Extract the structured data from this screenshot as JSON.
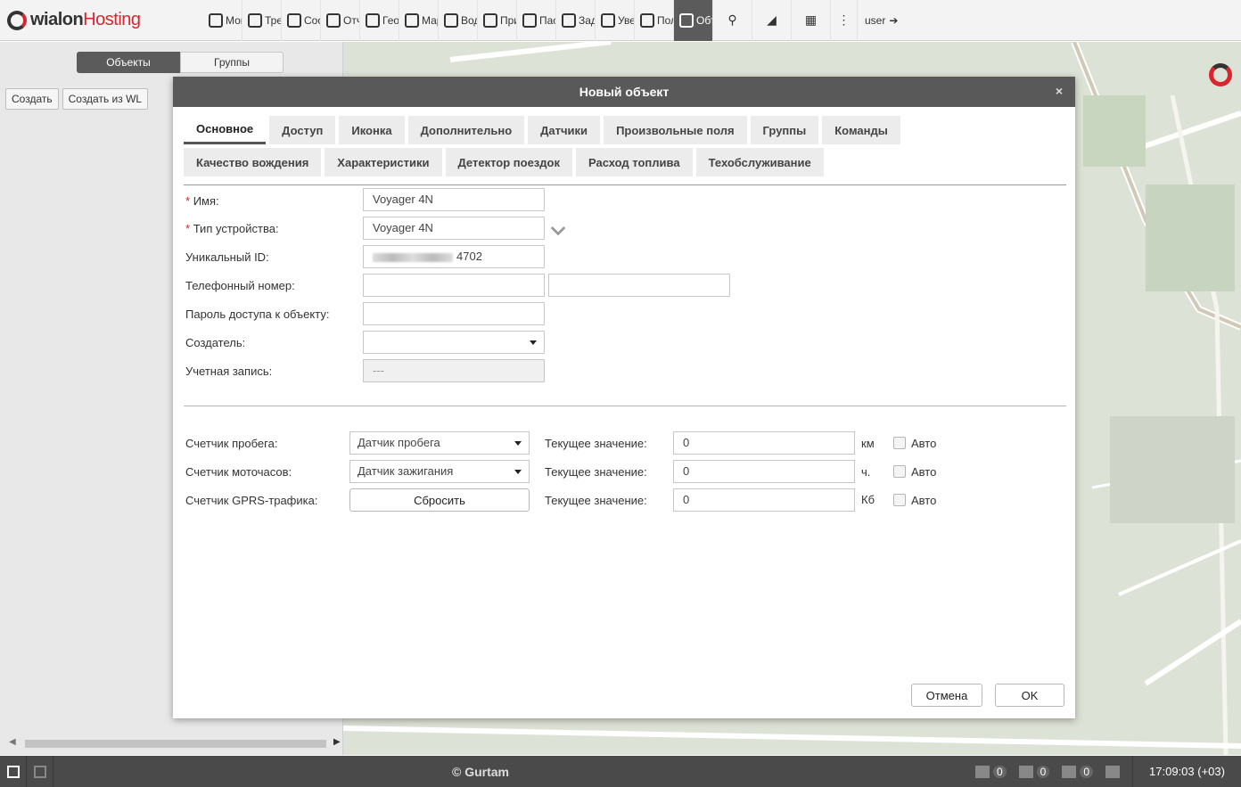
{
  "app": {
    "logo_main": "wialon",
    "logo_accent": "Hosting",
    "user": "user"
  },
  "menu": [
    {
      "label": "Мон",
      "icon": "globe-icon"
    },
    {
      "label": "Тре",
      "icon": "flag-icon"
    },
    {
      "label": "Соо",
      "icon": "list-icon"
    },
    {
      "label": "Отч",
      "icon": "report-icon"
    },
    {
      "label": "Гео",
      "icon": "geofence-icon"
    },
    {
      "label": "Мар",
      "icon": "route-icon"
    },
    {
      "label": "Вод",
      "icon": "steering-wheel-icon"
    },
    {
      "label": "При",
      "icon": "trailer-icon"
    },
    {
      "label": "Пас",
      "icon": "passenger-icon"
    },
    {
      "label": "Зад",
      "icon": "task-icon"
    },
    {
      "label": "Уве",
      "icon": "clock-icon"
    },
    {
      "label": "Пол",
      "icon": "user-icon"
    },
    {
      "label": "Объ",
      "icon": "vehicle-icon"
    }
  ],
  "left_panel": {
    "seg_objects": "Объекты",
    "seg_groups": "Группы",
    "btn_create": "Создать",
    "btn_create_wlp": "Создать из WL"
  },
  "dialog": {
    "title": "Новый объект",
    "close": "×",
    "tabs_row1": [
      "Основное",
      "Доступ",
      "Иконка",
      "Дополнительно",
      "Датчики",
      "Произвольные поля",
      "Группы",
      "Команды"
    ],
    "tabs_row2": [
      "Качество вождения",
      "Характеристики",
      "Детектор поездок",
      "Расход топлива",
      "Техобслуживание"
    ],
    "active_tab": "Основное",
    "fields": {
      "name_label": "Имя:",
      "name_value": "Voyager 4N",
      "device_type_label": "Тип устройства:",
      "device_type_value": "Voyager 4N",
      "unique_id_label": "Уникальный ID:",
      "unique_id_value": "4702",
      "phone_label": "Телефонный номер:",
      "phone_value": "",
      "phone_value2": "",
      "password_label": "Пароль доступа к объекту:",
      "password_value": "",
      "creator_label": "Создатель:",
      "creator_value": "",
      "account_label": "Учетная запись:",
      "account_value": "---"
    },
    "counters": {
      "mileage_label": "Счетчик пробега:",
      "mileage_select": "Датчик пробега",
      "engine_label": "Счетчик моточасов:",
      "engine_select": "Датчик зажигания",
      "gprs_label": "Счетчик GPRS-трафика:",
      "gprs_reset": "Сбросить",
      "current_label": "Текущее значение:",
      "mileage_value": "0",
      "engine_value": "0",
      "gprs_value": "0",
      "unit_km": "км",
      "unit_h": "ч.",
      "unit_kb": "Кб",
      "auto": "Авто"
    },
    "cancel": "Отмена",
    "ok": "OK"
  },
  "bottom": {
    "copyright": "© Gurtam",
    "count_events": "0",
    "count_messages": "0",
    "count_images": "0",
    "time": "17:09:03 (+03)"
  }
}
